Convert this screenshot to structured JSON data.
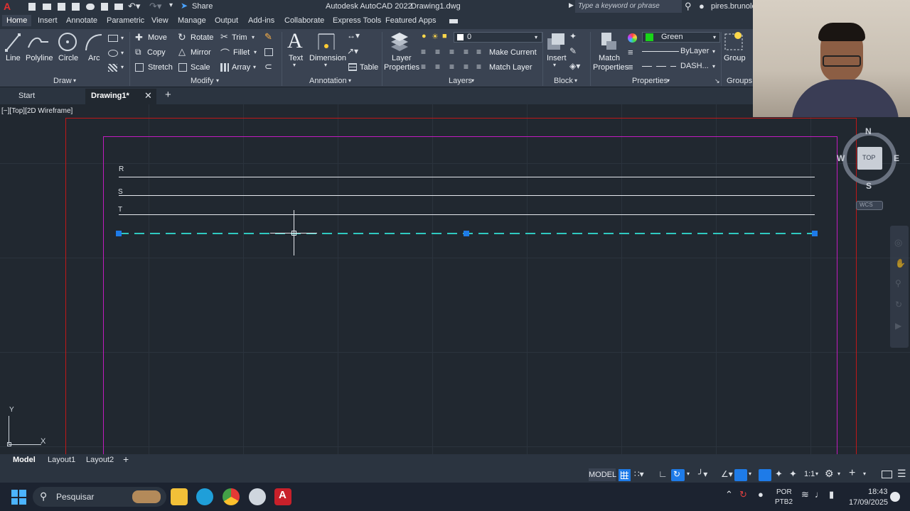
{
  "titlebar": {
    "app_title": "Autodesk AutoCAD 2022",
    "file_title": "Drawing1.dwg",
    "share_label": "Share",
    "search_placeholder": "Type a keyword or phrase",
    "user": "pires.brunole"
  },
  "ribbon_tabs": [
    "Home",
    "Insert",
    "Annotate",
    "Parametric",
    "View",
    "Manage",
    "Output",
    "Add-ins",
    "Collaborate",
    "Express Tools",
    "Featured Apps"
  ],
  "active_ribbon_tab": "Home",
  "draw": {
    "line": "Line",
    "polyline": "Polyline",
    "circle": "Circle",
    "arc": "Arc",
    "panel": "Draw"
  },
  "modify": {
    "move": "Move",
    "rotate": "Rotate",
    "trim": "Trim",
    "copy": "Copy",
    "mirror": "Mirror",
    "fillet": "Fillet",
    "stretch": "Stretch",
    "scale": "Scale",
    "array": "Array",
    "panel": "Modify"
  },
  "annotation": {
    "text": "Text",
    "dimension": "Dimension",
    "table": "Table",
    "panel": "Annotation"
  },
  "layers": {
    "layer_properties_1": "Layer",
    "layer_properties_2": "Properties",
    "current_layer": "0",
    "make_current": "Make Current",
    "match_layer": "Match Layer",
    "panel": "Layers"
  },
  "block": {
    "insert": "Insert",
    "panel": "Block"
  },
  "properties": {
    "match_1": "Match",
    "match_2": "Properties",
    "color": "Green",
    "color_hex": "#19d419",
    "lineweight": "ByLayer",
    "linetype": "DASH...",
    "panel": "Properties"
  },
  "groups": {
    "group": "Group",
    "panel": "Groups"
  },
  "doc_tabs": {
    "start": "Start",
    "drawing": "Drawing1*"
  },
  "viewport": {
    "view_label": "[−][Top][2D Wireframe]",
    "labels": [
      "R",
      "S",
      "T"
    ],
    "dashed_color": "#2fc9c0",
    "border_color": "#c21bbf",
    "ucs_x": "X",
    "ucs_y": "Y"
  },
  "viewcube": {
    "n": "N",
    "s": "S",
    "e": "E",
    "w": "W",
    "top": "TOP",
    "wcs": "WCS"
  },
  "layout_tabs": [
    "Model",
    "Layout1",
    "Layout2"
  ],
  "status": {
    "model": "MODEL",
    "scale": "1:1"
  },
  "taskbar": {
    "search": "Pesquisar",
    "lang_1": "POR",
    "lang_2": "PTB2",
    "time": "18:43",
    "date": "17/09/2025"
  }
}
